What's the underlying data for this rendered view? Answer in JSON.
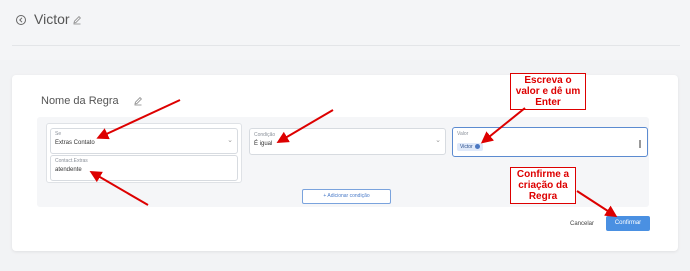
{
  "header": {
    "title": "Victor"
  },
  "rule": {
    "name_label": "Nome da Regra"
  },
  "conditions": {
    "se": {
      "label": "Se",
      "value": "Extras Contato"
    },
    "contact": {
      "label": "Contact.Extras",
      "value": "atendente"
    },
    "condicao": {
      "label": "Condição",
      "value": "É igual"
    },
    "valor": {
      "label": "Valor",
      "chip": "Victor"
    },
    "add_label": "+ Adicionar condição"
  },
  "actions": {
    "cancel_label": "Cancelar",
    "confirm_label": "Confirmar"
  },
  "annotations": {
    "write_value": "Escreva o valor e dê um Enter",
    "confirm_rule": "Confirme a criação da Regra"
  },
  "colors": {
    "accent": "#4a90e2",
    "annotation": "#dd0000"
  }
}
